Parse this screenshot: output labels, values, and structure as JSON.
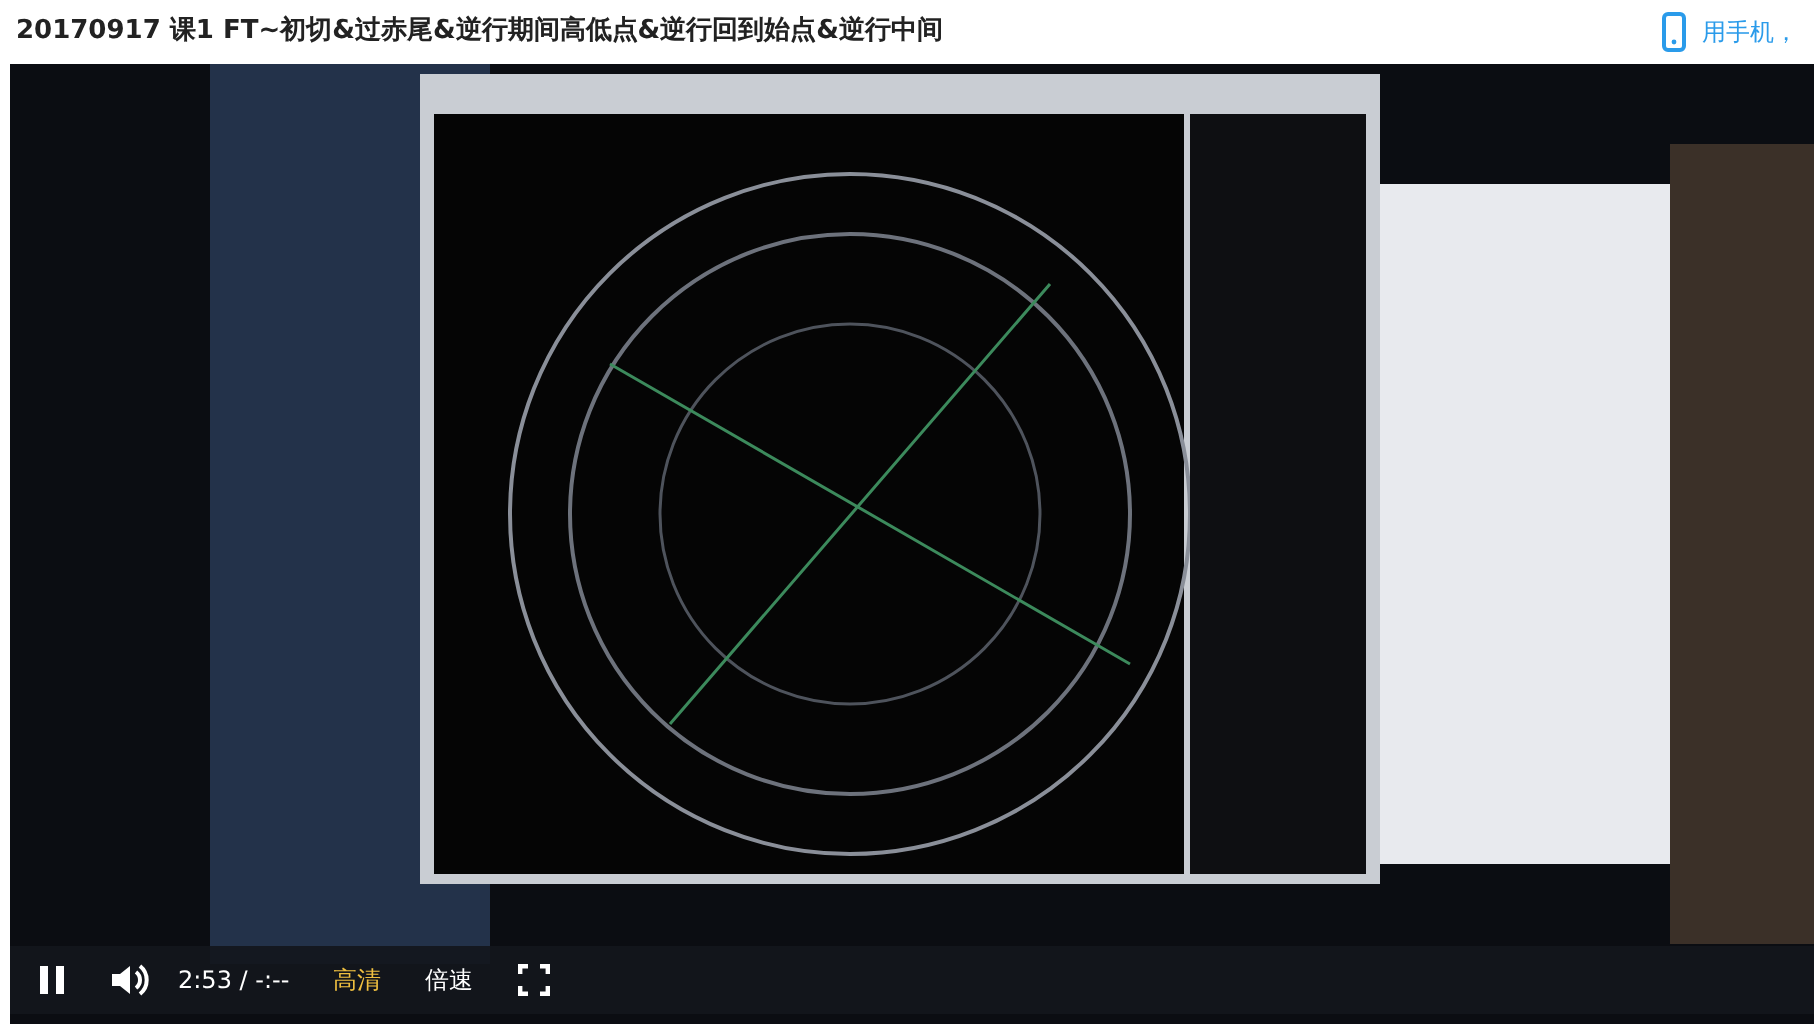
{
  "title": "20170917 课1 FT~初切&过赤尾&逆行期间高低点&逆行回到始点&逆行中间",
  "phone_link": "用手机，",
  "player": {
    "playing": true,
    "time": "2:53 / -:--",
    "quality": "高清",
    "speed": "倍速"
  }
}
